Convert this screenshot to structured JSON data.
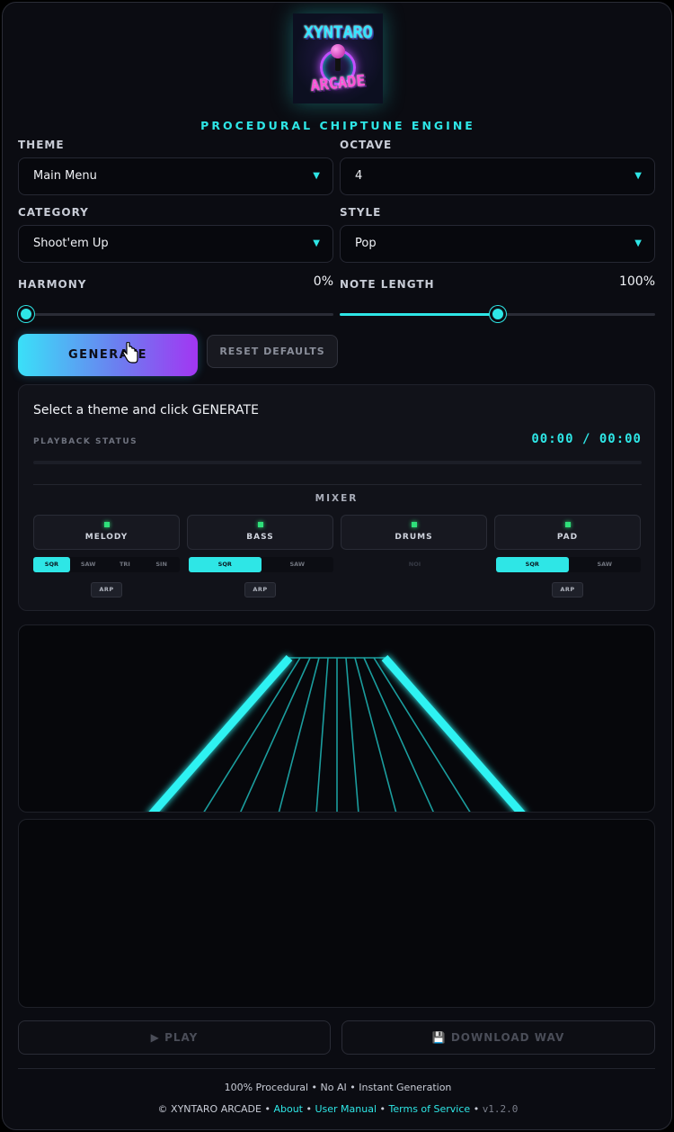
{
  "logo": {
    "line1": "XYNTARO",
    "line2": "ARCADE"
  },
  "tagline": "PROCEDURAL CHIPTUNE ENGINE",
  "controls": {
    "theme": {
      "label": "THEME",
      "value": "Main Menu"
    },
    "octave": {
      "label": "OCTAVE",
      "value": "4"
    },
    "category": {
      "label": "CATEGORY",
      "value": "Shoot'em Up"
    },
    "style": {
      "label": "STYLE",
      "value": "Pop"
    },
    "harmony": {
      "label": "HARMONY",
      "value": "0%",
      "level": 0
    },
    "note_length": {
      "label": "NOTE LENGTH",
      "value": "100%",
      "level": 0.5
    }
  },
  "buttons": {
    "generate": "GENERATE",
    "reset": "RESET DEFAULTS",
    "play": "▶ PLAY",
    "download": "💾 DOWNLOAD WAV"
  },
  "status": {
    "message": "Select a theme and click GENERATE",
    "label": "PLAYBACK STATUS",
    "current": "00:00",
    "separator": "/",
    "total": "00:00"
  },
  "mixer": {
    "title": "MIXER",
    "channels": [
      {
        "name": "MELODY",
        "waves": [
          "SQR",
          "SAW",
          "TRI",
          "SIN"
        ],
        "active": 0,
        "arp": "ARP"
      },
      {
        "name": "BASS",
        "waves": [
          "SQR",
          "SAW"
        ],
        "active": 0,
        "arp": "ARP"
      },
      {
        "name": "DRUMS",
        "waves": [
          "NOI"
        ],
        "active": -1,
        "arp": ""
      },
      {
        "name": "PAD",
        "waves": [
          "SQR",
          "SAW"
        ],
        "active": 0,
        "arp": "ARP"
      }
    ]
  },
  "footer": {
    "line1": "100% Procedural • No AI • Instant Generation",
    "copyright": "© XYNTARO ARCADE •",
    "about": "About",
    "manual": "User Manual",
    "terms": "Terms of Service",
    "dot": "•",
    "version": "v1.2.0"
  },
  "colors": {
    "accent": "#2ee6e6",
    "led": "#2fe07a",
    "gradient_end": "#a236f2"
  }
}
